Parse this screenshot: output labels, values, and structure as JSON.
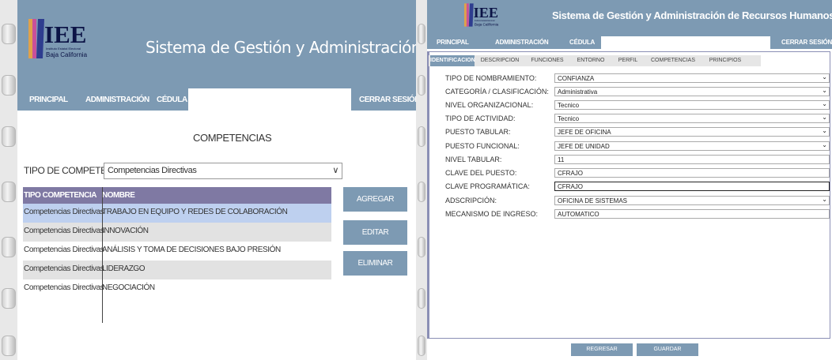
{
  "colors": {
    "header": "#7d9ab3",
    "table_header": "#7f79a3",
    "selected_row": "#bed0ef"
  },
  "left": {
    "logo": {
      "brand": "IEE",
      "sub1": "Instituto Estatal Electoral",
      "sub2": "Baja California"
    },
    "app_title": "Sistema de Gestión y Administración de Recursos Humanos",
    "nav": {
      "principal": "PRINCIPAL",
      "administracion": "ADMINISTRACIÓN",
      "cedula": "CÉDULA",
      "logout": "CERRAR SESIÓN"
    },
    "section_title": "COMPETENCIAS",
    "competency_type_label": "TIPO DE COMPETENCIA:",
    "competency_type_value": "Competencias Directivas",
    "table": {
      "headers": [
        "TIPO COMPETENCIA",
        "NOMBRE"
      ],
      "rows": [
        {
          "tipo": "Competencias Directivas",
          "nombre": "TRABAJO EN EQUIPO Y REDES DE COLABORACIÓN"
        },
        {
          "tipo": "Competencias Directivas",
          "nombre": "INNOVACIÓN"
        },
        {
          "tipo": "Competencias Directivas",
          "nombre": "ANÁLISIS Y TOMA DE DECISIONES BAJO PRESIÓN"
        },
        {
          "tipo": "Competencias Directivas",
          "nombre": "LIDERAZGO"
        },
        {
          "tipo": "Competencias Directivas",
          "nombre": "NEGOCIACIÓN"
        }
      ]
    },
    "buttons": {
      "add": "AGREGAR",
      "edit": "EDITAR",
      "delete": "ELIMINAR"
    }
  },
  "right": {
    "logo": {
      "brand": "IEE",
      "sub1": "Instituto Estatal Electoral",
      "sub2": "Baja California"
    },
    "app_title": "Sistema de Gestión y Administración de Recursos Humanos",
    "nav": {
      "principal": "PRINCIPAL",
      "administracion": "ADMINISTRACIÓN",
      "cedula": "CÉDULA",
      "logout": "CERRAR SESIÓN"
    },
    "tabs": [
      "IDENTIFICACION",
      "DESCRIPCION",
      "FUNCIONES",
      "ENTORNO",
      "PERFIL",
      "COMPETENCIAS",
      "PRINCIPIOS"
    ],
    "fields": [
      {
        "label": "TIPO DE NOMBRAMIENTO:",
        "value": "CONFIANZA"
      },
      {
        "label": "CATEGORÍA / CLASIFICACIÓN:",
        "value": "Administrativa"
      },
      {
        "label": "NIVEL ORGANIZACIONAL:",
        "value": "Tecnico"
      },
      {
        "label": "TIPO DE ACTIVIDAD:",
        "value": "Tecnico"
      },
      {
        "label": "PUESTO TABULAR:",
        "value": "JEFE DE OFICINA"
      },
      {
        "label": "PUESTO FUNCIONAL:",
        "value": "JEFE DE UNIDAD"
      },
      {
        "label": "NIVEL TABULAR:",
        "value": "11"
      },
      {
        "label": "CLAVE DEL PUESTO:",
        "value": "CFRAJO"
      },
      {
        "label": "CLAVE PROGRAMÁTICA:",
        "value": "CFRAJO"
      },
      {
        "label": "ADSCRIPCIÓN:",
        "value": "OFICINA DE SISTEMAS"
      },
      {
        "label": "MECANISMO DE INGRESO:",
        "value": "AUTOMATICO"
      }
    ],
    "buttons": {
      "back": "REGRESAR",
      "save": "GUARDAR"
    }
  }
}
